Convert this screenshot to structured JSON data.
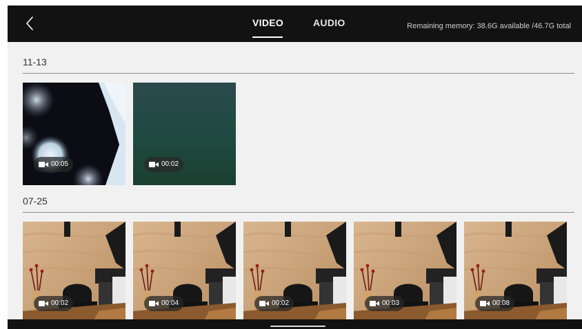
{
  "header": {
    "tabs": [
      {
        "label": "VIDEO",
        "active": true
      },
      {
        "label": "AUDIO",
        "active": false
      }
    ],
    "memory": "Remaining memory: 38.6G available /46.7G total"
  },
  "sections": [
    {
      "date": "11-13",
      "items": [
        {
          "duration": "00:05",
          "thumb": "dark-bokeh"
        },
        {
          "duration": "00:02",
          "thumb": "green-blur"
        }
      ]
    },
    {
      "date": "07-25",
      "items": [
        {
          "duration": "00:02",
          "thumb": "office-desk"
        },
        {
          "duration": "00:04",
          "thumb": "office-desk"
        },
        {
          "duration": "00:02",
          "thumb": "office-desk"
        },
        {
          "duration": "00:03",
          "thumb": "office-desk"
        },
        {
          "duration": "00:08",
          "thumb": "office-desk"
        }
      ]
    }
  ],
  "colors": {
    "topbar": "#121212",
    "background": "#f1f1f1",
    "badge": "#282828"
  }
}
